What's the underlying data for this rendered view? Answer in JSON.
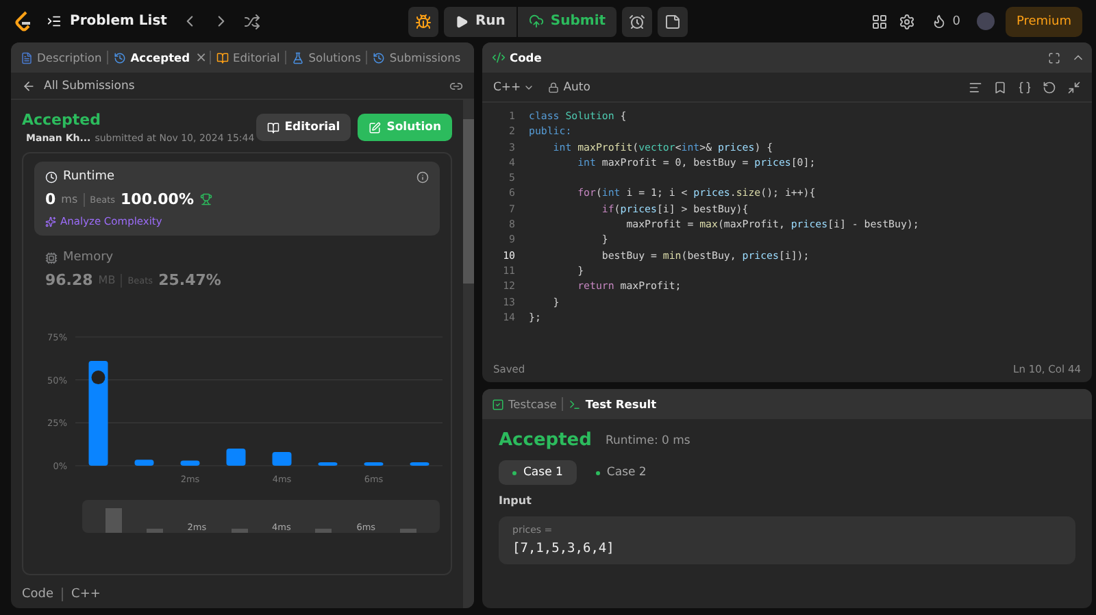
{
  "topbar": {
    "title": "Problem List",
    "run": "Run",
    "submit": "Submit",
    "streak": "0",
    "premium": "Premium"
  },
  "left": {
    "tabs": [
      {
        "label": "Description",
        "selected": false,
        "closable": false
      },
      {
        "label": "Accepted",
        "selected": true,
        "closable": true
      },
      {
        "label": "Editorial",
        "selected": false,
        "closable": false
      },
      {
        "label": "Solutions",
        "selected": false,
        "closable": false
      },
      {
        "label": "Submissions",
        "selected": false,
        "closable": false
      }
    ],
    "close_glyph": "×",
    "back": "All Submissions",
    "status": "Accepted",
    "author": "Manan Kh...",
    "submitted": "submitted at Nov 10, 2024 15:44",
    "buttons": [
      {
        "label": "Editorial",
        "kind": "secondary"
      },
      {
        "label": "Solution",
        "kind": "primary"
      }
    ],
    "metrics": [
      {
        "title": "Runtime",
        "value": "0",
        "unit": "ms",
        "beats_label": "Beats",
        "beats": "100.00%",
        "selected": true,
        "link": "Analyze Complexity"
      },
      {
        "title": "Memory",
        "value": "96.28",
        "unit": "MB",
        "beats_label": "Beats",
        "beats": "25.47%",
        "selected": false
      }
    ],
    "chart_data": {
      "type": "bar",
      "x": [
        0,
        1,
        2,
        3,
        4,
        5,
        6,
        7
      ],
      "values": [
        61,
        3.5,
        3,
        10,
        8,
        2,
        2,
        2
      ],
      "xlim": [
        -0.5,
        7.5
      ],
      "ylim": [
        0,
        75
      ],
      "yticks": [
        {
          "value": 0,
          "label": "0%"
        },
        {
          "value": 25,
          "label": "25%"
        },
        {
          "value": 50,
          "label": "50%"
        },
        {
          "value": 75,
          "label": "75%"
        }
      ],
      "xticks": [
        {
          "value": 2,
          "label": "2ms"
        },
        {
          "value": 4,
          "label": "4ms"
        },
        {
          "value": 6,
          "label": "6ms"
        }
      ]
    },
    "overview_labels": [
      "2ms",
      "4ms",
      "6ms"
    ],
    "footer": {
      "label": "Code",
      "language": "C++"
    }
  },
  "code": {
    "title": "Code",
    "language": "C++",
    "mode": "Auto",
    "saved": "Saved",
    "cursor": "Ln 10, Col 44",
    "lines": [
      {
        "no": "1",
        "current": false,
        "tokens": [
          {
            "kind": "kw",
            "text": "class "
          },
          {
            "kind": "type",
            "text": "Solution"
          },
          {
            "kind": "plain",
            "text": " {"
          }
        ]
      },
      {
        "no": "2",
        "current": false,
        "tokens": [
          {
            "kind": "kw",
            "text": "public:"
          }
        ]
      },
      {
        "no": "3",
        "current": false,
        "tokens": [
          {
            "kind": "kw",
            "text": "    int "
          },
          {
            "kind": "fn",
            "text": "maxProfit"
          },
          {
            "kind": "plain",
            "text": "("
          },
          {
            "kind": "type",
            "text": "vector"
          },
          {
            "kind": "plain",
            "text": "<"
          },
          {
            "kind": "kw",
            "text": "int"
          },
          {
            "kind": "plain",
            "text": ">& "
          },
          {
            "kind": "var",
            "text": "prices"
          },
          {
            "kind": "plain",
            "text": ") {"
          }
        ]
      },
      {
        "no": "4",
        "current": false,
        "tokens": [
          {
            "kind": "kw",
            "text": "        int "
          },
          {
            "kind": "plain",
            "text": "maxProfit = 0, bestBuy = "
          },
          {
            "kind": "var",
            "text": "prices"
          },
          {
            "kind": "plain",
            "text": "[0];"
          }
        ]
      },
      {
        "no": "5",
        "current": false
      },
      {
        "no": "6",
        "current": false,
        "tokens": [
          {
            "kind": "ctrl",
            "text": "        for"
          },
          {
            "kind": "plain",
            "text": "("
          },
          {
            "kind": "kw",
            "text": "int "
          },
          {
            "kind": "plain",
            "text": "i = 1; i < "
          },
          {
            "kind": "var",
            "text": "prices"
          },
          {
            "kind": "plain",
            "text": "."
          },
          {
            "kind": "fn",
            "text": "size"
          },
          {
            "kind": "plain",
            "text": "(); i++){"
          }
        ]
      },
      {
        "no": "7",
        "current": false,
        "tokens": [
          {
            "kind": "ctrl",
            "text": "            if"
          },
          {
            "kind": "plain",
            "text": "("
          },
          {
            "kind": "var",
            "text": "prices"
          },
          {
            "kind": "plain",
            "text": "[i] > bestBuy){"
          }
        ]
      },
      {
        "no": "8",
        "current": false,
        "tokens": [
          {
            "kind": "plain",
            "text": "                maxProfit = "
          },
          {
            "kind": "fn",
            "text": "max"
          },
          {
            "kind": "plain",
            "text": "(maxProfit, "
          },
          {
            "kind": "var",
            "text": "prices"
          },
          {
            "kind": "plain",
            "text": "[i] - bestBuy);"
          }
        ]
      },
      {
        "no": "9",
        "current": false,
        "tokens": [
          {
            "kind": "plain",
            "text": "            }"
          }
        ]
      },
      {
        "no": "10",
        "current": true,
        "tokens": [
          {
            "kind": "plain",
            "text": "            bestBuy = "
          },
          {
            "kind": "fn",
            "text": "min"
          },
          {
            "kind": "plain",
            "text": "(bestBuy, "
          },
          {
            "kind": "var",
            "text": "prices"
          },
          {
            "kind": "plain",
            "text": "[i]);"
          }
        ]
      },
      {
        "no": "11",
        "current": false,
        "tokens": [
          {
            "kind": "plain",
            "text": "        }"
          }
        ]
      },
      {
        "no": "12",
        "current": false,
        "tokens": [
          {
            "kind": "ctrl",
            "text": "        return "
          },
          {
            "kind": "plain",
            "text": "maxProfit;"
          }
        ]
      },
      {
        "no": "13",
        "current": false,
        "tokens": [
          {
            "kind": "plain",
            "text": "    }"
          }
        ]
      },
      {
        "no": "14",
        "current": false,
        "tokens": [
          {
            "kind": "plain",
            "text": "};"
          }
        ]
      }
    ]
  },
  "result": {
    "tabs": [
      {
        "label": "Testcase",
        "selected": false
      },
      {
        "label": "Test Result",
        "selected": true
      }
    ],
    "status": "Accepted",
    "runtime": "Runtime: 0 ms",
    "cases": [
      {
        "label": "Case 1",
        "selected": true
      },
      {
        "label": "Case 2",
        "selected": false
      }
    ],
    "input_label": "Input",
    "param": "prices =",
    "value": "[7,1,5,3,6,4]"
  }
}
